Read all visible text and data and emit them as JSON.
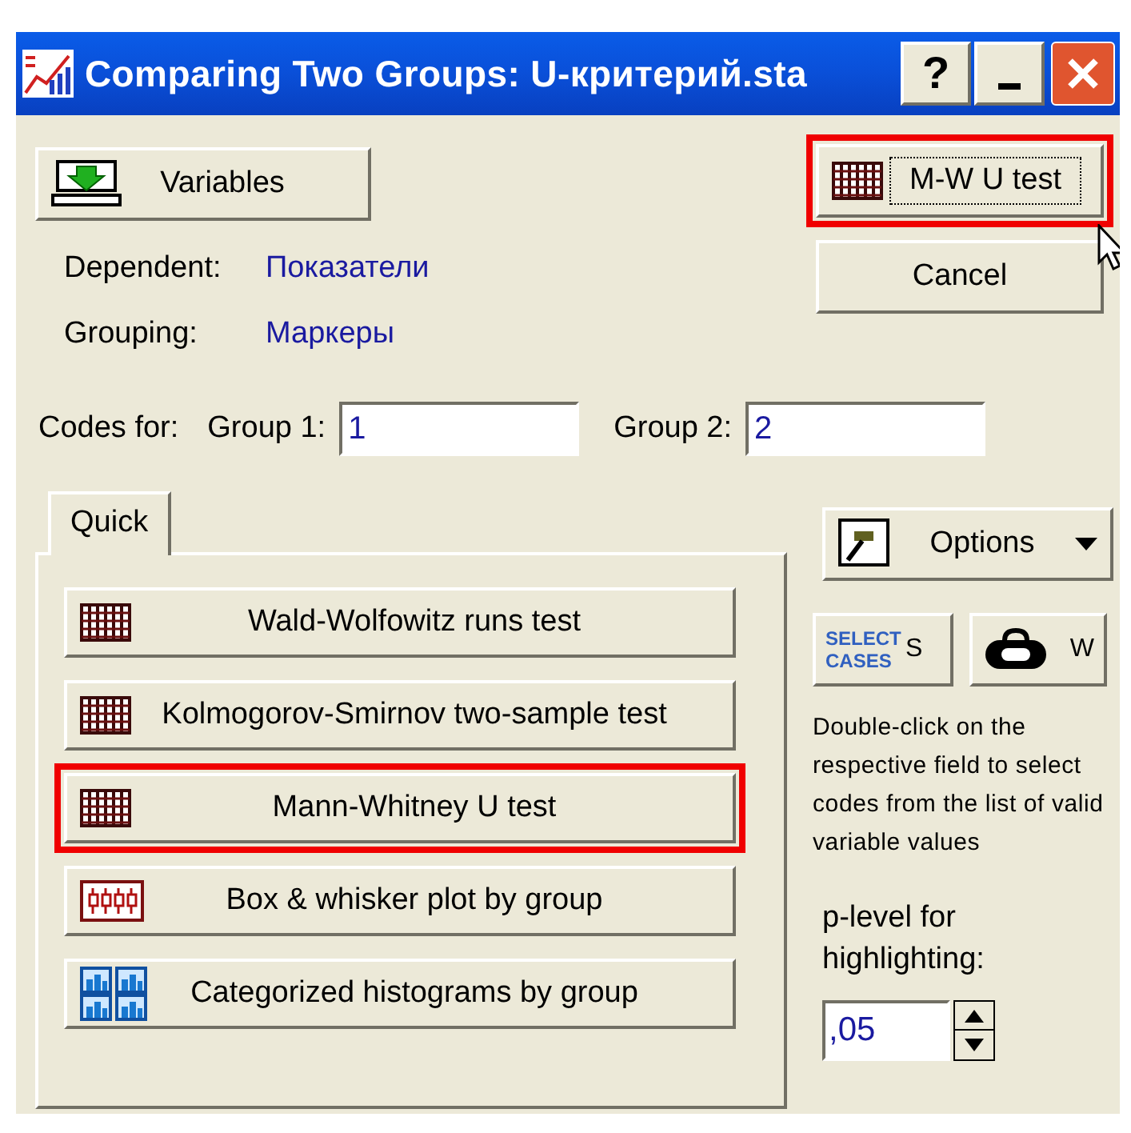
{
  "window": {
    "title": "Comparing Two Groups: U-критерий.sta",
    "help_button": "?"
  },
  "variables_button": {
    "label": "Variables"
  },
  "variables": [
    {
      "label": "Dependent:",
      "value": "Показатели"
    },
    {
      "label": "Grouping:",
      "value": "Маркеры"
    }
  ],
  "actions": [
    {
      "label": "M-W U test",
      "kind": "grid",
      "highlighted": true,
      "focused": true
    },
    {
      "label": "Cancel",
      "kind": "plain",
      "highlighted": false,
      "focused": false
    }
  ],
  "codes": {
    "label": "Codes for:",
    "groups": [
      {
        "label": "Group 1:",
        "value": "1"
      },
      {
        "label": "Group 2:",
        "value": "2"
      }
    ]
  },
  "tabs": [
    {
      "label": "Quick",
      "selected": true
    }
  ],
  "quick_buttons": [
    {
      "label": "Wald-Wolfowitz runs test",
      "kind": "grid",
      "highlighted": false
    },
    {
      "label": "Kolmogorov-Smirnov two-sample test",
      "kind": "grid",
      "highlighted": false
    },
    {
      "label": "Mann-Whitney U test",
      "kind": "grid",
      "highlighted": true
    },
    {
      "label": "Box & whisker plot by group",
      "kind": "boxplot",
      "highlighted": false
    },
    {
      "label": "Categorized histograms by group",
      "kind": "histograms",
      "highlighted": false
    }
  ],
  "options_button": {
    "label": "Options"
  },
  "tool_buttons": [
    {
      "kind": "select_cases",
      "badge": "SELECT CASES",
      "label": "S"
    },
    {
      "kind": "weight",
      "label": "W"
    }
  ],
  "hint": "Double-click on the respective field to select codes from the list of valid variable values",
  "p_level": {
    "label": "p-level for highlighting:",
    "value": ",05"
  }
}
